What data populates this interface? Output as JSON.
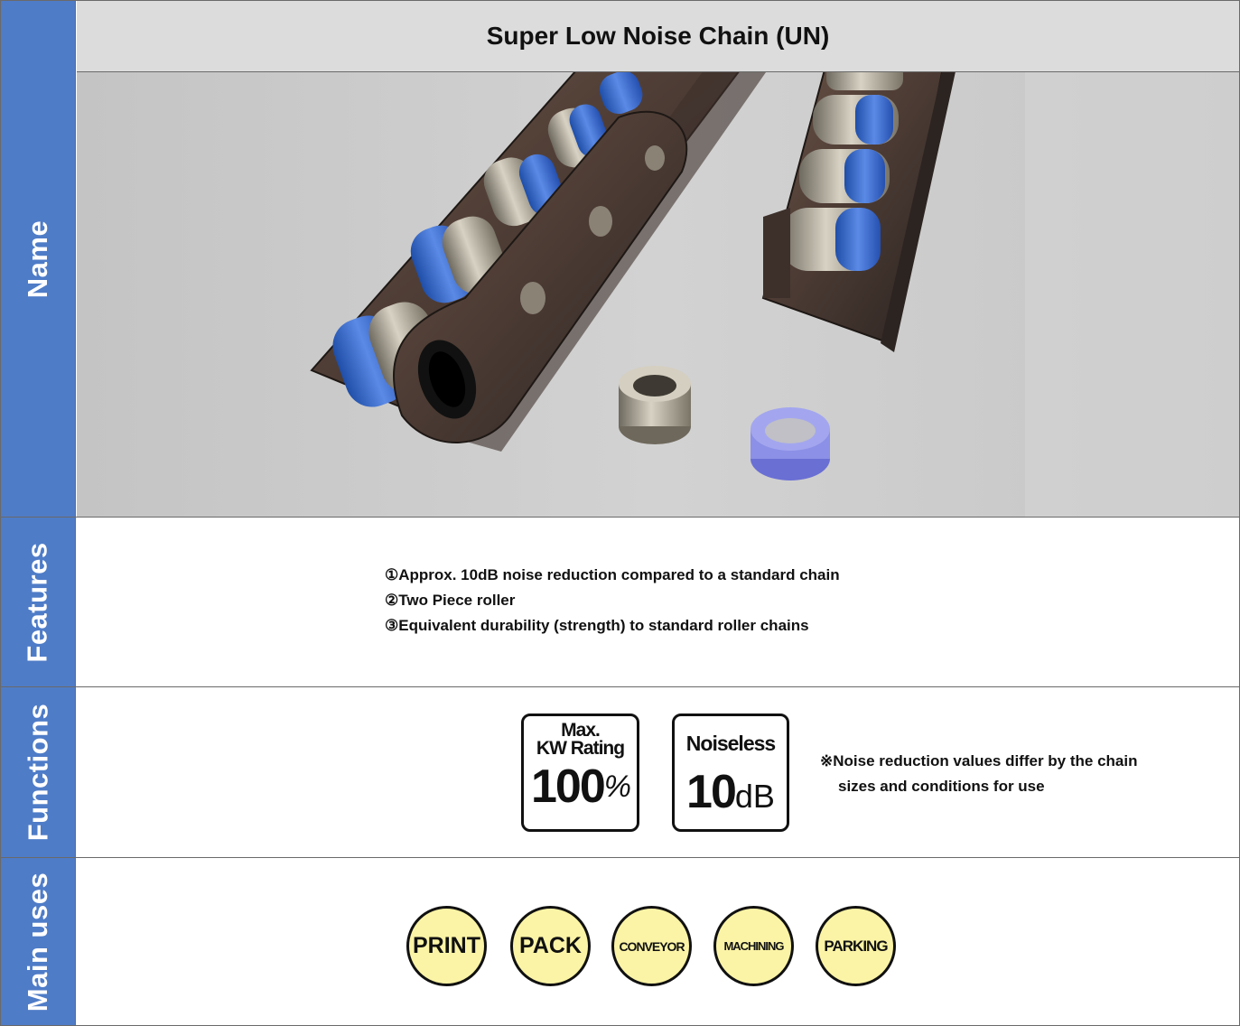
{
  "product": {
    "title": "Super Low Noise Chain (UN)"
  },
  "sections": {
    "name": "Name",
    "features": "Features",
    "functions": "Functions",
    "main_uses": "Main uses"
  },
  "features": [
    "①Approx. 10dB noise reduction compared to a standard chain",
    "②Two Piece roller",
    "③Equivalent durability (strength) to standard roller chains"
  ],
  "functions": {
    "kw_badge": {
      "line1": "Max.",
      "line2": "KW Rating",
      "value": "100",
      "unit": "%"
    },
    "noise_badge": {
      "label": "Noiseless",
      "value": "10",
      "unit": "dB"
    },
    "note_line1": "※Noise reduction values differ by the chain",
    "note_line2": "sizes and conditions for use"
  },
  "main_uses": [
    "PRINT",
    "PACK",
    "CONVEYOR",
    "MACHINING",
    "PARKING"
  ],
  "colors": {
    "section_blue": "#4f7cc7",
    "title_gray": "#dcdcdc",
    "use_yellow": "#fbf4a6",
    "roller_blue": "#3a6ad0"
  }
}
